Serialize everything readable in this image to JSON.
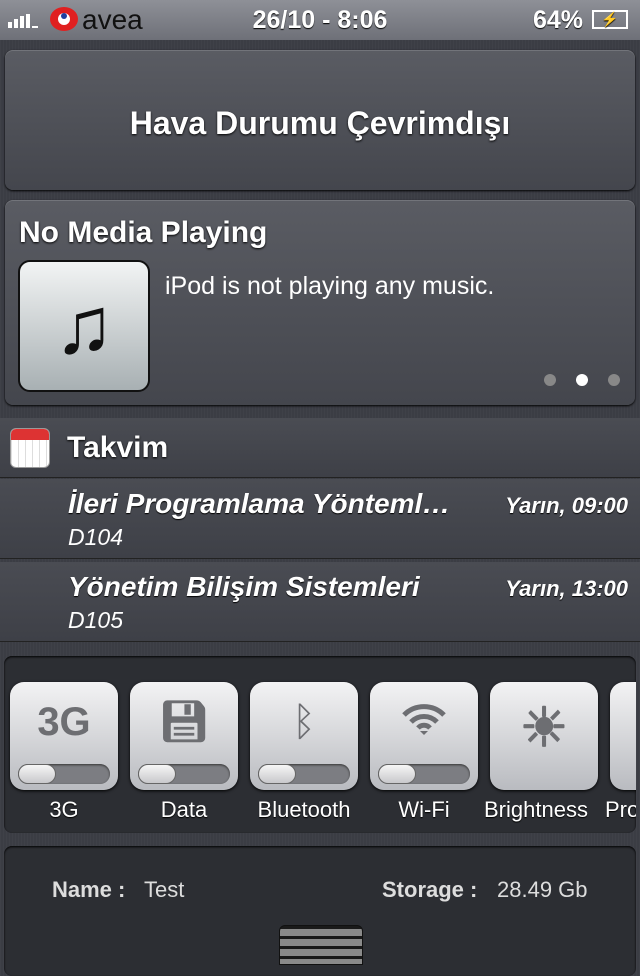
{
  "status_bar": {
    "carrier": "avea",
    "datetime": "26/10 - 8:06",
    "battery": "64%",
    "battery_level": 64,
    "signal_bars": 4
  },
  "weather": {
    "text": "Hava Durumu Çevrimdışı"
  },
  "media": {
    "title": "No Media Playing",
    "message": "iPod is not playing any music.",
    "page_count": 3,
    "current_page": 2
  },
  "calendar": {
    "title": "Takvim",
    "events": [
      {
        "title": "İleri Programlama Yönteml…",
        "time": "Yarın, 09:00",
        "location": "D104"
      },
      {
        "title": "Yönetim Bilişim Sistemleri",
        "time": "Yarın, 13:00",
        "location": "D105"
      }
    ]
  },
  "toggles": [
    {
      "label": "3G",
      "icon": "3G",
      "on": false
    },
    {
      "label": "Data",
      "icon": "floppy-disk-icon",
      "on": false
    },
    {
      "label": "Bluetooth",
      "icon": "bluetooth-icon",
      "on": false
    },
    {
      "label": "Wi-Fi",
      "icon": "wifi-icon",
      "on": false
    },
    {
      "label": "Brightness",
      "icon": "sun-icon"
    },
    {
      "label": "Pro",
      "icon": ""
    }
  ],
  "info": {
    "name_label": "Name :",
    "name_value": "Test",
    "storage_label": "Storage :",
    "storage_value": "28.49 Gb"
  }
}
